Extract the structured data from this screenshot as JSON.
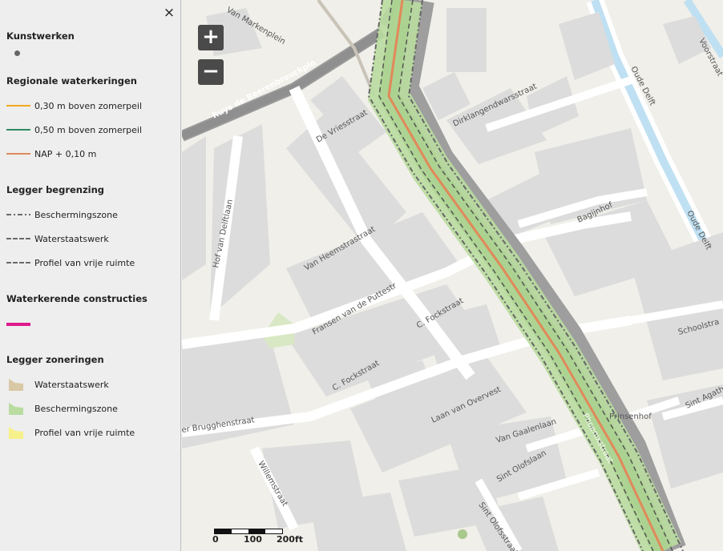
{
  "legend": {
    "close_glyph": "×",
    "sections": {
      "kunstwerken": {
        "title": "Kunstwerken"
      },
      "regionale": {
        "title": "Regionale waterkeringen",
        "items": [
          {
            "label": "0,30 m boven zomerpeil",
            "color": "#f2a91e"
          },
          {
            "label": "0,50 m boven zomerpeil",
            "color": "#2e8a5f"
          },
          {
            "label": "NAP + 0,10 m",
            "color": "#e0895a"
          }
        ]
      },
      "begrenzing": {
        "title": "Legger begrenzing",
        "items": [
          {
            "label": "Beschermingszone"
          },
          {
            "label": "Waterstaatswerk"
          },
          {
            "label": "Profiel van vrije ruimte"
          }
        ]
      },
      "constructies": {
        "title": "Waterkerende constructies",
        "color": "#e0188c"
      },
      "zoneringen": {
        "title": "Legger zoneringen",
        "items": [
          {
            "label": "Waterstaatswerk",
            "color": "#d9c8a6"
          },
          {
            "label": "Beschermingszone",
            "color": "#b9dca0"
          },
          {
            "label": "Profiel van vrije ruimte",
            "color": "#f6f08a"
          }
        ]
      }
    }
  },
  "map": {
    "zoom_in": "+",
    "zoom_out": "−",
    "streets": {
      "van_markenplein": "Van Markenplein",
      "ruys": "Ruys de Beerenbrouckpln",
      "de_vriesstraat": "De Vriesstraat",
      "dirklangendwarsstraat": "Dirklangendwarsstraat",
      "oude_delft_1": "Oude Delft",
      "oude_delft_2": "Oude Delft",
      "voorstraat": "Voorstraat",
      "bagijnhof": "Bagijnhof",
      "hof_van_delftlaan": "Hof van Delftlaan",
      "van_heemstrastraat": "Van Heemstrastraat",
      "fransen": "Fransen van de Puttestr",
      "c_fockstraat_1": "C. Fockstraat",
      "c_fockstraat_2": "C. Fockstraat",
      "schoolstraat": "Schoolstra",
      "sint_agatha": "Sint Agath",
      "prinsenhof": "Prinsenhof",
      "laan_van_overvest": "Laan van Overvest",
      "van_gaalenlaan": "Van Gaalenlaan",
      "van_brugghenstraat": "er Brugghenstraat",
      "willemstraat": "Willemstraat",
      "sint_olofslaan": "Sint Olofslaan",
      "sint_olofsstraat": "Sint Olofsstraat",
      "phoenixstraat": "Phoenixstraat"
    },
    "scale": {
      "zero": "0",
      "mid": "100",
      "end": "200ft"
    }
  }
}
